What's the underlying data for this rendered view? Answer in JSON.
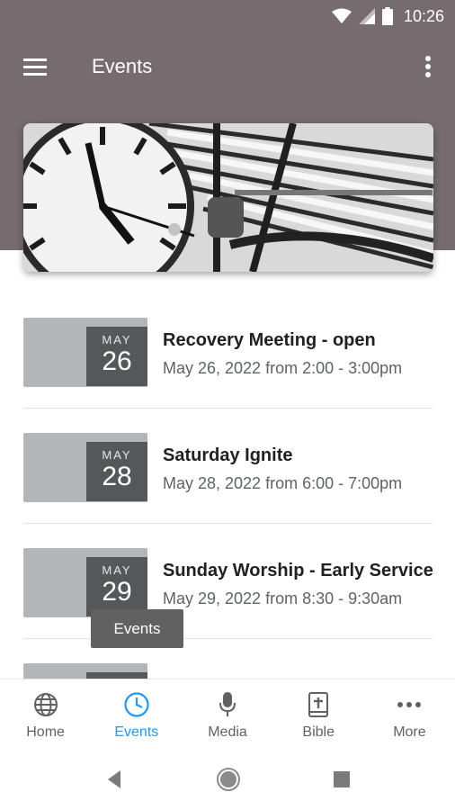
{
  "status_bar": {
    "time": "10:26"
  },
  "toolbar": {
    "title": "Events"
  },
  "events": [
    {
      "month": "MAY",
      "day": "26",
      "title": "Recovery Meeting - open",
      "subtitle": "May 26, 2022 from 2:00 - 3:00pm"
    },
    {
      "month": "MAY",
      "day": "28",
      "title": "Saturday Ignite",
      "subtitle": "May 28, 2022 from 6:00 - 7:00pm"
    },
    {
      "month": "MAY",
      "day": "29",
      "title": "Sunday Worship - Early Service",
      "subtitle": "May 29, 2022 from 8:30 - 9:30am"
    },
    {
      "month": "",
      "day": "",
      "title": "",
      "subtitle": ""
    }
  ],
  "tooltip": {
    "text": "Events"
  },
  "bottom_nav": {
    "items": [
      {
        "label": "Home",
        "icon": "globe-icon"
      },
      {
        "label": "Events",
        "icon": "clock-icon",
        "active": true
      },
      {
        "label": "Media",
        "icon": "microphone-icon"
      },
      {
        "label": "Bible",
        "icon": "bible-icon"
      },
      {
        "label": "More",
        "icon": "more-horizontal-icon"
      }
    ]
  },
  "colors": {
    "header": "#766c70",
    "accent": "#2196f3",
    "date_box": "#555759",
    "thumb": "#b3b5b8"
  }
}
